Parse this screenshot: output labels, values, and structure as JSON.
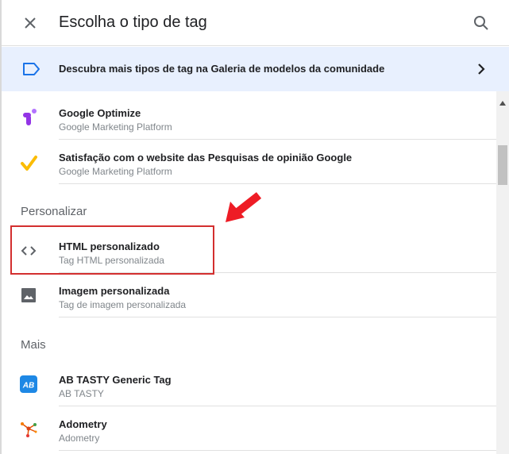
{
  "header": {
    "title": "Escolha o tipo de tag"
  },
  "banner": {
    "text": "Descubra mais tipos de tag na Galeria de modelos da comunidade"
  },
  "sections": {
    "custom": "Personalizar",
    "more": "Mais"
  },
  "items": [
    {
      "name": "Google Optimize",
      "sub": "Google Marketing Platform",
      "icon": "google-optimize-icon"
    },
    {
      "name": "Satisfação com o website das Pesquisas de opinião Google",
      "sub": "Google Marketing Platform",
      "icon": "google-surveys-icon"
    },
    {
      "name": "HTML personalizado",
      "sub": "Tag HTML personalizada",
      "icon": "code-icon"
    },
    {
      "name": "Imagem personalizada",
      "sub": "Tag de imagem personalizada",
      "icon": "image-icon"
    },
    {
      "name": "AB TASTY Generic Tag",
      "sub": "AB TASTY",
      "icon": "ab-tasty-icon"
    },
    {
      "name": "Adometry",
      "sub": "Adometry",
      "icon": "adometry-icon"
    }
  ],
  "colors": {
    "banner_bg": "#e8f0fe",
    "accent_blue": "#1a73e8",
    "highlight_red": "#d32f2f",
    "optimize_purple": "#9334e6",
    "surveys_yellow": "#fbbc04"
  }
}
